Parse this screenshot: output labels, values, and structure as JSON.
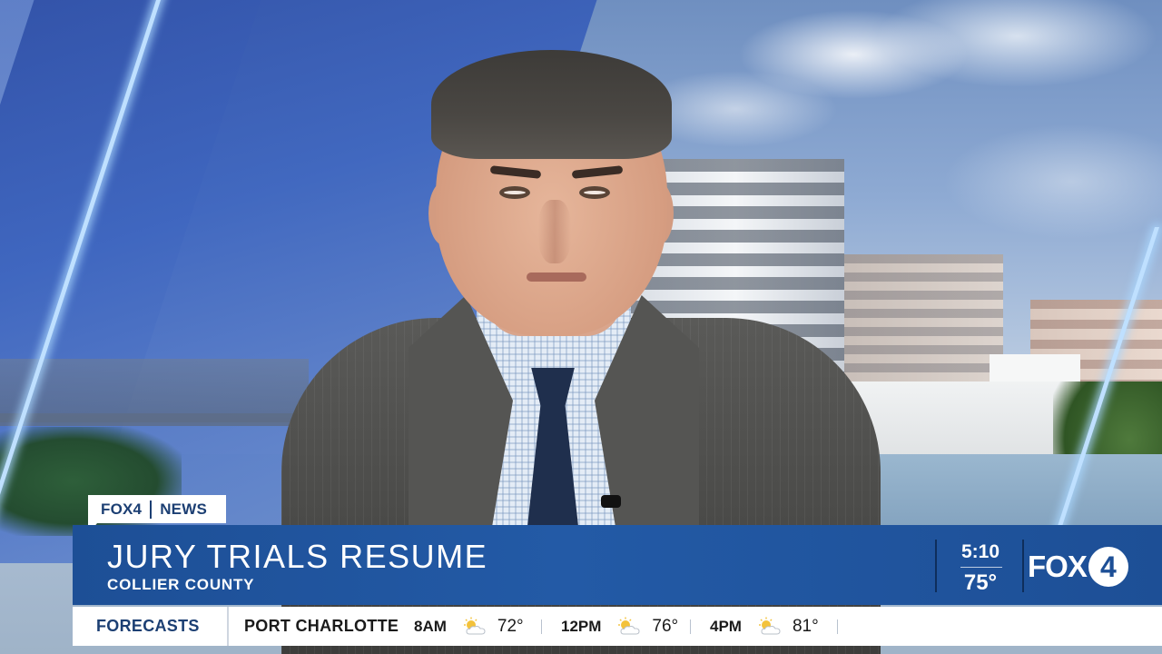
{
  "tag": {
    "brand": "FOX4",
    "label": "NEWS"
  },
  "headline": "JURY TRIALS RESUME",
  "subhead": "COLLIER COUNTY",
  "clock": {
    "time": "5:10",
    "temp": "75°"
  },
  "logo": {
    "text": "FOX",
    "digit": "4"
  },
  "ticker": {
    "label": "FORECASTS",
    "city": "PORT CHARLOTTE",
    "slots": [
      {
        "time": "8AM",
        "icon": "partly-sunny-icon",
        "temp": "72°"
      },
      {
        "time": "12PM",
        "icon": "partly-sunny-icon",
        "temp": "76°"
      },
      {
        "time": "4PM",
        "icon": "partly-sunny-icon",
        "temp": "81°"
      }
    ]
  },
  "colors": {
    "banner": "#1d4f96",
    "brand_text": "#1c3f73",
    "accent_glow": "#bfe0ff"
  }
}
